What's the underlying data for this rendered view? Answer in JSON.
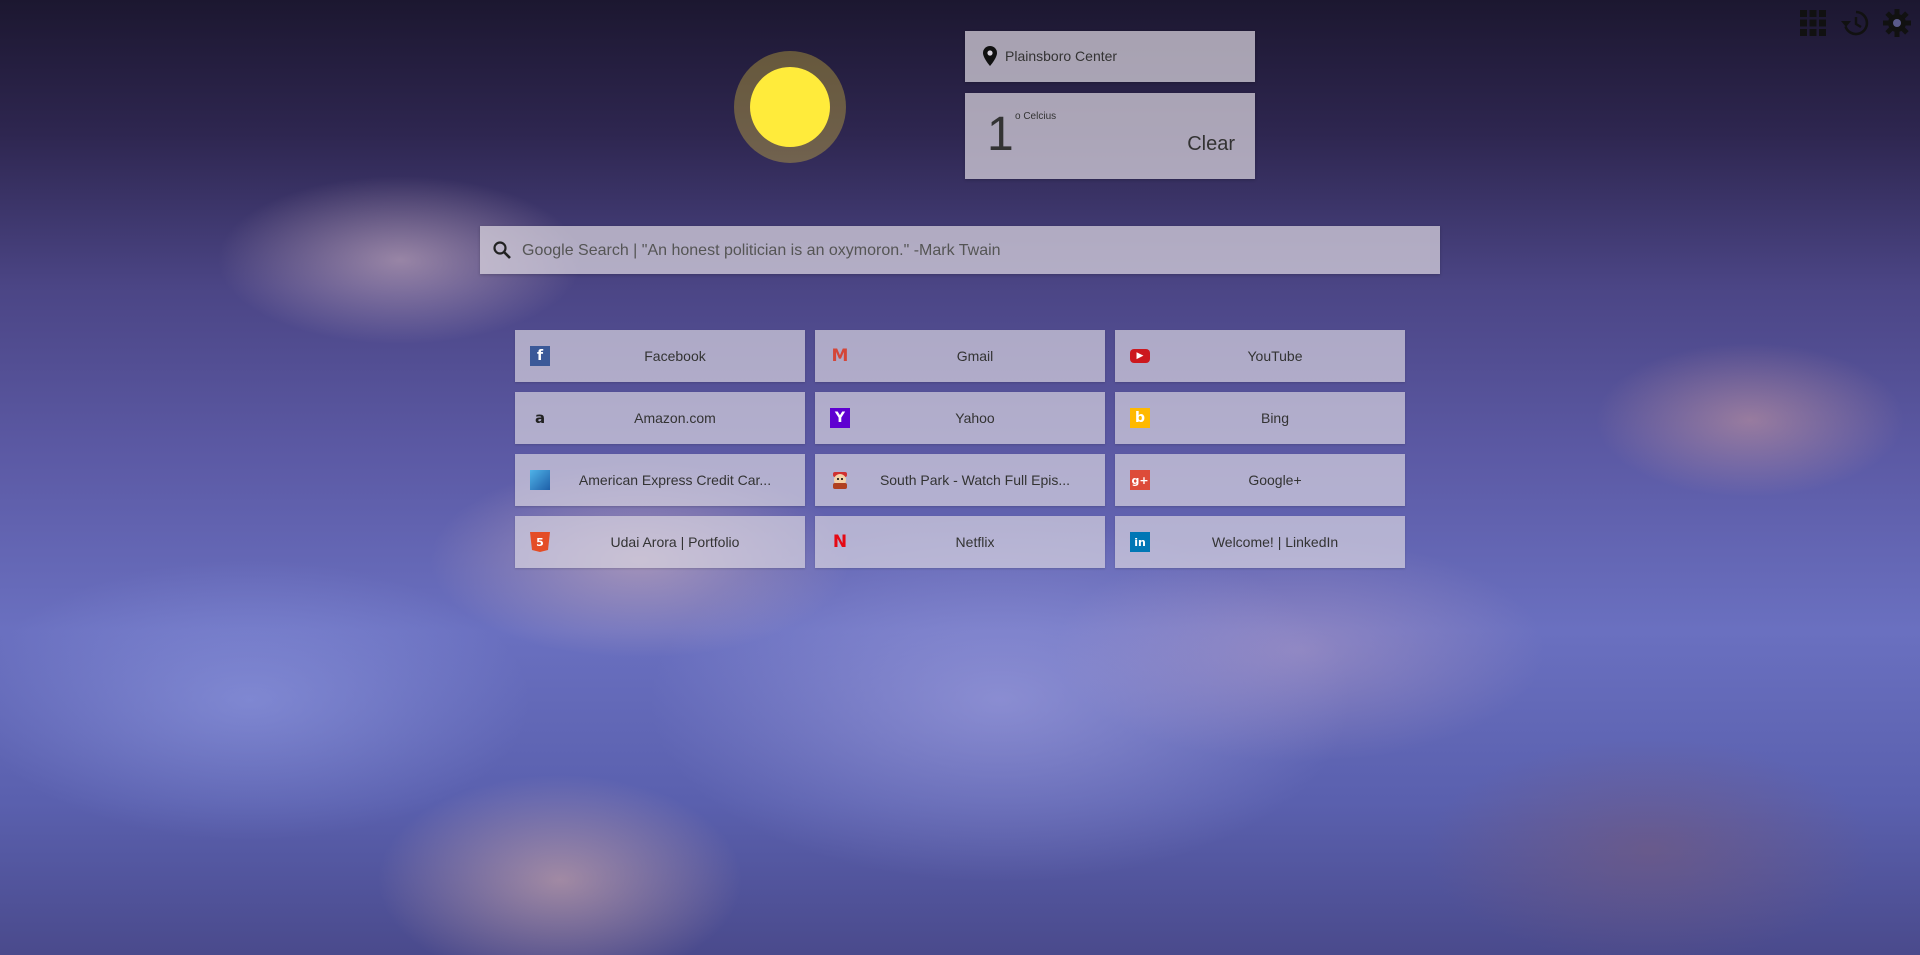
{
  "topbar": {
    "icons": [
      "apps-grid-icon",
      "history-icon",
      "settings-gear-icon"
    ]
  },
  "weather": {
    "location": "Plainsboro Center",
    "temperature": "1",
    "unit": "o Celcius",
    "clear_label": "Clear",
    "sun_color": "#ffeb3b"
  },
  "search": {
    "placeholder": "Google Search | \"An honest politician is an oxymoron.\" -Mark Twain"
  },
  "tiles": [
    {
      "label": "Facebook",
      "icon": "facebook-icon",
      "color": "#3b5998"
    },
    {
      "label": "Gmail",
      "icon": "gmail-icon",
      "color": "#d44638"
    },
    {
      "label": "YouTube",
      "icon": "youtube-icon",
      "color": "#cc181e"
    },
    {
      "label": "Amazon.com",
      "icon": "amazon-icon",
      "color": "#222222"
    },
    {
      "label": "Yahoo",
      "icon": "yahoo-icon",
      "color": "#5f01d1"
    },
    {
      "label": "Bing",
      "icon": "bing-icon",
      "color": "#ffb900"
    },
    {
      "label": "American Express Credit Car...",
      "icon": "amex-icon",
      "color": "#2e77bc"
    },
    {
      "label": "South Park - Watch Full Epis...",
      "icon": "south-park-icon",
      "color": "#d03030"
    },
    {
      "label": "Google+",
      "icon": "google-plus-icon",
      "color": "#dd4b39"
    },
    {
      "label": "Udai Arora | Portfolio",
      "icon": "html5-icon",
      "color": "#e44d26"
    },
    {
      "label": "Netflix",
      "icon": "netflix-icon",
      "color": "#e50914"
    },
    {
      "label": "Welcome! | LinkedIn",
      "icon": "linkedin-icon",
      "color": "#0077b5"
    }
  ]
}
